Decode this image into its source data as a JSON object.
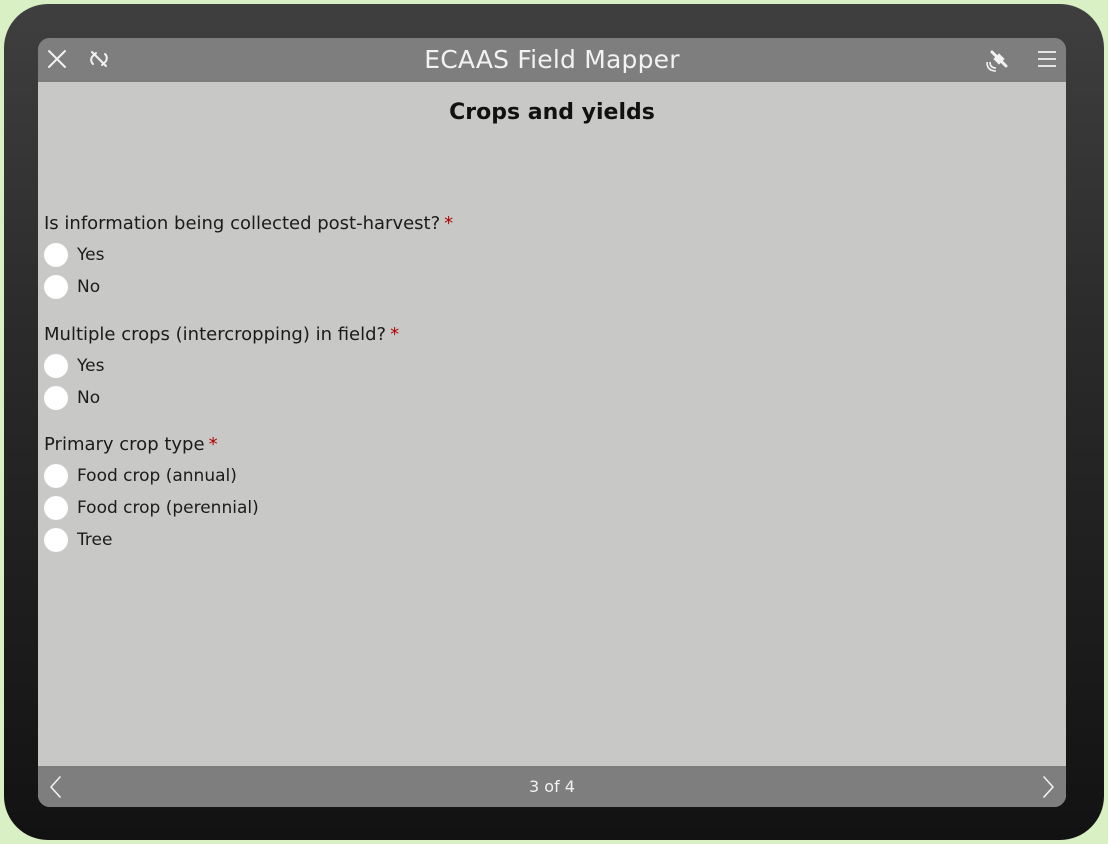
{
  "header": {
    "title": "ECAAS Field Mapper",
    "icons": [
      "close-icon",
      "no-link-icon",
      "gps-satellite-icon",
      "menu-icon"
    ]
  },
  "page": {
    "heading": "Crops and yields"
  },
  "questions": [
    {
      "label": "Is information being collected post-harvest?",
      "required_marker": "*",
      "options": [
        "Yes",
        "No"
      ]
    },
    {
      "label": "Multiple crops (intercropping) in field?",
      "required_marker": "*",
      "options": [
        "Yes",
        "No"
      ]
    },
    {
      "label": "Primary crop type",
      "required_marker": "*",
      "options": [
        "Food crop (annual)",
        "Food crop (perennial)",
        "Tree"
      ]
    }
  ],
  "footer": {
    "page_indicator": "3 of 4"
  },
  "colors": {
    "bar": "#7e7e7e",
    "content_bg": "#c8c8c6",
    "required": "#b00000",
    "page_bg": "#d9f0c4"
  }
}
